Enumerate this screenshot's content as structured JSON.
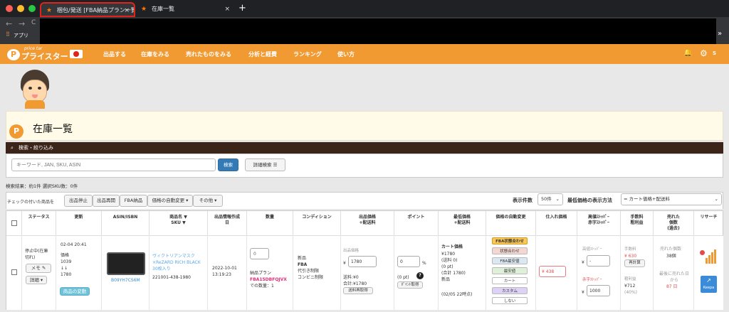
{
  "browser": {
    "tabs": [
      {
        "label": "梱包/発送 [FBA納品プラン一覧]",
        "active": true
      },
      {
        "label": "在庫一覧",
        "active": false
      }
    ],
    "new_tab": "+",
    "bookmark": "アプリ",
    "overflow": "»"
  },
  "nav": {
    "logo_small": "price tar",
    "logo": "プライスター",
    "items": [
      "出品する",
      "在庫をみる",
      "売れたものをみる",
      "分析と経費",
      "ランキング",
      "使い方"
    ],
    "user": "S"
  },
  "page": {
    "title": "在庫一覧",
    "search_header": "検索・絞り込み",
    "search_placeholder": "キーワード, JAN, SKU, ASIN",
    "search_button": "検索",
    "detail_search_button": "詳細検索",
    "result_text": "検索結果：約1件 選択SKU数：0件",
    "check_label": "チェックの付いた商品を",
    "actions": [
      "出品停止",
      "出品再開",
      "FBA納品",
      "価格の自動変更 ▾",
      "その他 ▾"
    ],
    "display_count_label": "表示件数",
    "display_count": "50件",
    "lowest_price_label": "最低価格の表示方法",
    "lowest_price_value": "= カート価格+配送料"
  },
  "columns": [
    "ステータス",
    "更新",
    "ASIN/ISBN",
    "商品名 ▼\nSKU ▼",
    "出品情報作成\n日",
    "数量",
    "コンディション",
    "出品価格\n+配送料",
    "ポイント",
    "最低価格\n+配送料",
    "価格の自動変更",
    "仕入れ価格",
    "高値ｽﾄｯﾊﾟｰ\n赤字ｽﾄｯﾊﾟｰ",
    "手数料\n粗利益",
    "売れた\n個数\n(過去)",
    "リサーチ"
  ],
  "row": {
    "status": "停止中(在庫\n切れ)",
    "memo": "メモ",
    "detail": "詳細",
    "updated": "02-04 20:41",
    "price_label": "価格",
    "price_hist_1": "1039",
    "price_hist_arrow": "↓↓",
    "price_hist_2": "1780",
    "change_button": "商品の変動",
    "asin": "B09YH7CS6M",
    "product_name": "ヴィクトリアンマスク\n×ReZARD RICH BLACK\n30枚入り",
    "sku": "221001-438-1980",
    "created": "2022-10-01\n13:19:23",
    "quantity_value": "0",
    "plan_label": "納品プラン",
    "plan_id": "FBA15DBFQJVX",
    "plan_qty": "での数量：1",
    "condition_1": "新品",
    "condition_2": "FBA",
    "condition_3": "代引き制限",
    "condition_4": "コンビニ制限",
    "listing_price_label": "出品価格",
    "listing_price": "1780",
    "shipping": "送料:¥0",
    "total": "合計:¥1780",
    "reprice_button": "送料再取得",
    "points_value": "0",
    "points_pct": "%",
    "points_pt": "(0 pt)",
    "points_button": "ﾎﾟｲﾝﾄ取得",
    "cart_label": "カート価格",
    "cart_price": "¥1780",
    "cart_shipping": "(送料 0)",
    "cart_pt": "(0 pt)",
    "cart_total": "(合計 1780)",
    "cart_condition": "新品",
    "cart_time": "(02/05 22時点)",
    "auto_options": [
      "FBA状態合わせ",
      "状態合わせ",
      "FBA最安値",
      "最安値",
      "カート",
      "カスタム",
      "しない"
    ],
    "purchase_price": "438",
    "high_stopper_label": "高値ｽﾄｯﾊﾟｰ",
    "high_stopper": "-",
    "low_stopper_label": "赤字ｽﾄｯﾊﾟｰ",
    "low_stopper": "1000",
    "fee_label": "手数料",
    "fee": "¥ 630",
    "recalc_button": "再計算",
    "profit_label": "粗利益",
    "profit": "¥712",
    "profit_pct": "(40%)",
    "sold_label": "売れた個数",
    "sold_count": "38個",
    "last_sold_label": "最後に売れた日\nから",
    "last_sold": "87 日",
    "keepa": "Keepa",
    "currency": "¥",
    "help": "?"
  },
  "colors": {
    "accent": "#f29a32",
    "dark_bar": "#3b2418",
    "selected_tab_border": "#e1241b"
  }
}
